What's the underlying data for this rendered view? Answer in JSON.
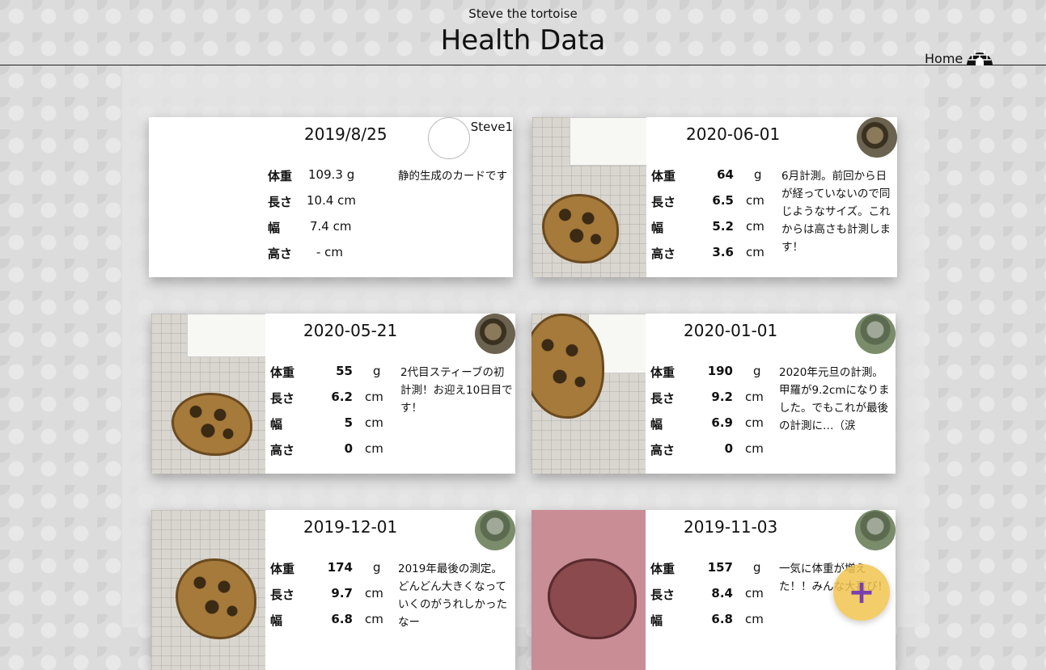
{
  "header": {
    "subtitle": "Steve the tortoise",
    "title": "Health Data",
    "home_label": "Home"
  },
  "labels": {
    "weight": "体重",
    "length": "長さ",
    "width": "幅",
    "height": "高さ",
    "unit_weight": "g",
    "unit_length": "cm"
  },
  "cards": [
    {
      "date": "2019/8/25",
      "owner": "Steve1",
      "weight": "109.3 g",
      "length": "10.4 cm",
      "width": "7.4 cm",
      "height": "- cm",
      "note": "静的生成のカードです"
    },
    {
      "date": "2020-06-01",
      "weight": "64",
      "length": "6.5",
      "width": "5.2",
      "height": "3.6",
      "note": "6月計測。前回から日が経っていないので同じようなサイズ。これからは高さも計測します！"
    },
    {
      "date": "2020-05-21",
      "weight": "55",
      "length": "6.2",
      "width": "5",
      "height": "0",
      "note": "2代目スティーブの初計測！お迎え10日目です！"
    },
    {
      "date": "2020-01-01",
      "weight": "190",
      "length": "9.2",
      "width": "6.9",
      "height": "0",
      "note": "2020年元旦の計測。甲羅が9.2cmになりました。でもこれが最後の計測に…（涙"
    },
    {
      "date": "2019-12-01",
      "weight": "174",
      "length": "9.7",
      "width": "6.8",
      "note": "2019年最後の測定。どんどん大きくなっていくのがうれしかったなー"
    },
    {
      "date": "2019-11-03",
      "weight": "157",
      "length": "8.4",
      "width": "6.8",
      "note": "一気に体重が増えた！！みんな大喜び！"
    }
  ],
  "fab": {
    "label": "+"
  },
  "colors": {
    "fab": "#f0c450",
    "fab_icon": "#7a3fb0"
  }
}
